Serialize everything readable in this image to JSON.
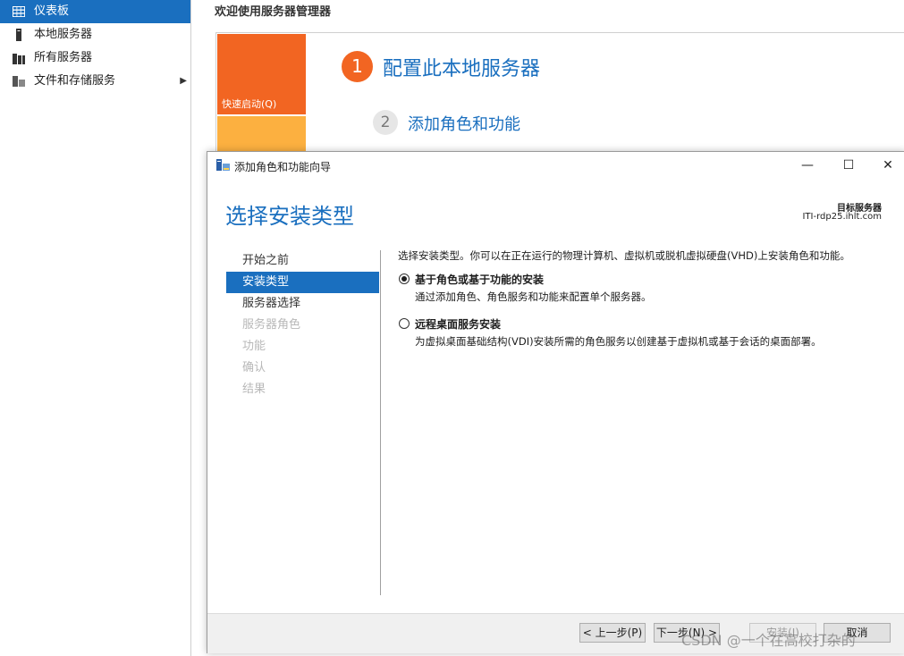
{
  "nav": {
    "items": [
      {
        "label": "仪表板",
        "icon": "dashboard-grid-icon",
        "active": true
      },
      {
        "label": "本地服务器",
        "icon": "server-icon",
        "active": false
      },
      {
        "label": "所有服务器",
        "icon": "servers-icon",
        "active": false
      },
      {
        "label": "文件和存储服务",
        "icon": "storage-icon",
        "active": false,
        "expandable": true
      }
    ]
  },
  "main": {
    "welcome_title": "欢迎使用服务器管理器",
    "quick_start_label": "快速启动(Q)",
    "steps": [
      {
        "number": "1",
        "label": "配置此本地服务器"
      },
      {
        "number": "2",
        "label": "添加角色和功能"
      }
    ]
  },
  "wizard": {
    "title": "添加角色和功能向导",
    "heading": "选择安装类型",
    "target_label": "目标服务器",
    "target_value": "ITI-rdp25.ihlt.com",
    "window_controls": {
      "minimize": "—",
      "maximize": "☐",
      "close": "✕"
    },
    "nav_steps": [
      {
        "label": "开始之前",
        "state": "normal"
      },
      {
        "label": "安装类型",
        "state": "active"
      },
      {
        "label": "服务器选择",
        "state": "normal"
      },
      {
        "label": "服务器角色",
        "state": "disabled"
      },
      {
        "label": "功能",
        "state": "disabled"
      },
      {
        "label": "确认",
        "state": "disabled"
      },
      {
        "label": "结果",
        "state": "disabled"
      }
    ],
    "intro": "选择安装类型。你可以在正在运行的物理计算机、虚拟机或脱机虚拟硬盘(VHD)上安装角色和功能。",
    "options": [
      {
        "title": "基于角色或基于功能的安装",
        "description": "通过添加角色、角色服务和功能来配置单个服务器。",
        "selected": true
      },
      {
        "title": "远程桌面服务安装",
        "description": "为虚拟桌面基础结构(VDI)安装所需的角色服务以创建基于虚拟机或基于会话的桌面部署。",
        "selected": false
      }
    ],
    "buttons": {
      "prev": "< 上一步(P)",
      "next": "下一步(N) >",
      "install": "安装(I)",
      "cancel": "取消"
    }
  },
  "watermark": "CSDN @一个在高校打杂的",
  "colors": {
    "accent": "#1a6fbf",
    "orange": "#f26522",
    "yellow": "#fcb040"
  }
}
